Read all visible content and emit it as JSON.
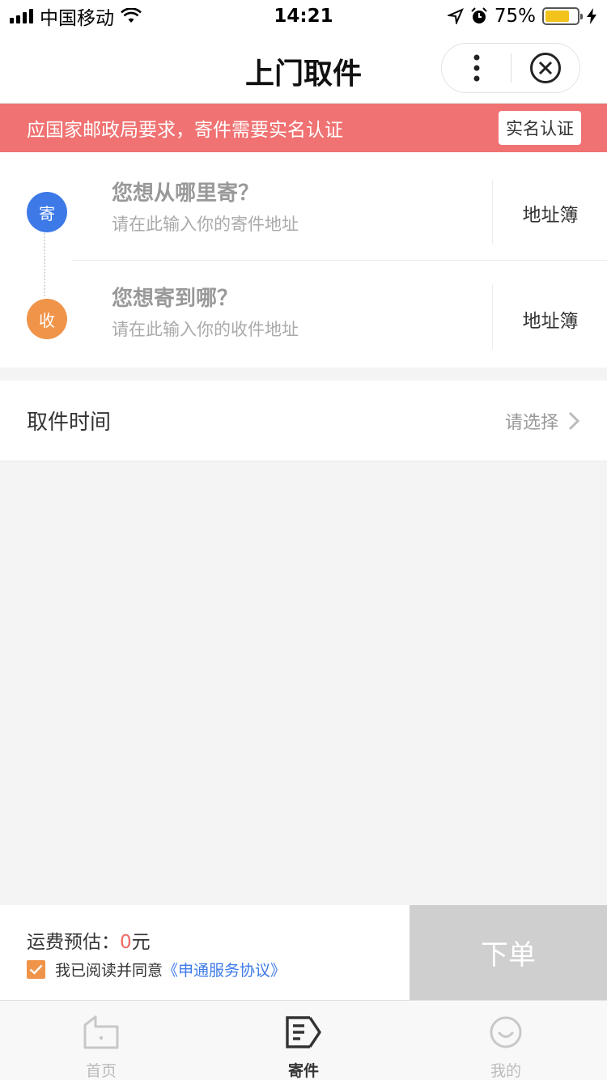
{
  "status_bar": {
    "carrier": "中国移动",
    "time": "14:21",
    "battery_percent": "75%",
    "battery_level": 0.75,
    "icons": [
      "signal-icon",
      "wifi-icon",
      "location-icon",
      "alarm-icon",
      "battery-icon",
      "charging-icon"
    ]
  },
  "nav": {
    "title": "上门取件",
    "icons": [
      "more-icon",
      "close-icon"
    ]
  },
  "banner": {
    "text": "应国家邮政局要求，寄件需要实名认证",
    "button_label": "实名认证"
  },
  "sender": {
    "badge": "寄",
    "title": "您想从哪里寄？",
    "hint": "请在此输入你的寄件地址",
    "address_book_label": "地址簿"
  },
  "receiver": {
    "badge": "收",
    "title": "您想寄到哪？",
    "hint": "请在此输入你的收件地址",
    "address_book_label": "地址簿"
  },
  "pickup": {
    "label": "取件时间",
    "value": "请选择"
  },
  "order": {
    "fee_label": "运费预估：",
    "fee_amount": "0",
    "fee_unit": "元",
    "agree_text": "我已阅读并同意",
    "agreement_link": "《申通服务协议》",
    "agree_checked": true,
    "submit_label": "下单"
  },
  "colors": {
    "banner": "#f07272",
    "sender_badge": "#3d7ae8",
    "receiver_badge": "#f0944a",
    "fee_amount": "#ef6a63",
    "link": "#3d7ae8",
    "submit_disabled": "#cfcfcf"
  },
  "tab_bar": {
    "tabs": [
      {
        "label": "首页",
        "icon": "home-icon",
        "active": false
      },
      {
        "label": "寄件",
        "icon": "send-edit-icon",
        "active": true
      },
      {
        "label": "我的",
        "icon": "smiley-icon",
        "active": false
      }
    ]
  }
}
